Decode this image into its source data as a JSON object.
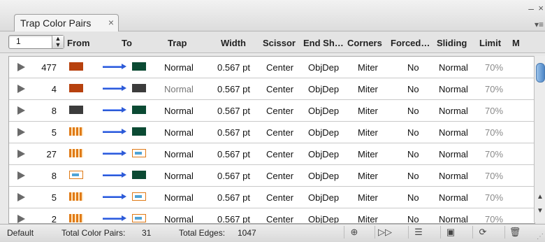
{
  "window": {
    "minimize_glyph": "–",
    "close_glyph": "×",
    "menu_glyph": "▾≡"
  },
  "tab": {
    "label": "Trap Color Pairs",
    "close_glyph": "×"
  },
  "stepper": {
    "value": "1",
    "arrows_glyph": "▲▼"
  },
  "columns": {
    "from": "From",
    "to": "To",
    "trap": "Trap",
    "width": "Width",
    "scissor": "Scissor",
    "end_shape": "End Sh…",
    "corners": "Corners",
    "forced": "Forced…",
    "sliding": "Sliding",
    "limit": "Limit",
    "m": "M"
  },
  "rows": [
    {
      "count": "477",
      "from": "rust",
      "to": "green",
      "trap": "Normal",
      "trap_gray": false,
      "width": "0.567 pt",
      "scissor": "Center",
      "end": "ObjDep",
      "corners": "Miter",
      "forced": "No",
      "sliding": "Normal",
      "limit": "70%"
    },
    {
      "count": "4",
      "from": "rust",
      "to": "dark",
      "trap": "Normal",
      "trap_gray": true,
      "width": "0.567 pt",
      "scissor": "Center",
      "end": "ObjDep",
      "corners": "Miter",
      "forced": "No",
      "sliding": "Normal",
      "limit": "70%"
    },
    {
      "count": "8",
      "from": "dark",
      "to": "green",
      "trap": "Normal",
      "trap_gray": false,
      "width": "0.567 pt",
      "scissor": "Center",
      "end": "ObjDep",
      "corners": "Miter",
      "forced": "No",
      "sliding": "Normal",
      "limit": "70%"
    },
    {
      "count": "5",
      "from": "stripe",
      "to": "green",
      "trap": "Normal",
      "trap_gray": false,
      "width": "0.567 pt",
      "scissor": "Center",
      "end": "ObjDep",
      "corners": "Miter",
      "forced": "No",
      "sliding": "Normal",
      "limit": "70%"
    },
    {
      "count": "27",
      "from": "stripe",
      "to": "img",
      "trap": "Normal",
      "trap_gray": false,
      "width": "0.567 pt",
      "scissor": "Center",
      "end": "ObjDep",
      "corners": "Miter",
      "forced": "No",
      "sliding": "Normal",
      "limit": "70%"
    },
    {
      "count": "8",
      "from": "img",
      "to": "green",
      "trap": "Normal",
      "trap_gray": false,
      "width": "0.567 pt",
      "scissor": "Center",
      "end": "ObjDep",
      "corners": "Miter",
      "forced": "No",
      "sliding": "Normal",
      "limit": "70%"
    },
    {
      "count": "5",
      "from": "stripe",
      "to": "img",
      "trap": "Normal",
      "trap_gray": false,
      "width": "0.567 pt",
      "scissor": "Center",
      "end": "ObjDep",
      "corners": "Miter",
      "forced": "No",
      "sliding": "Normal",
      "limit": "70%"
    },
    {
      "count": "2",
      "from": "stripe",
      "to": "img",
      "trap": "Normal",
      "trap_gray": false,
      "width": "0.567 pt",
      "scissor": "Center",
      "end": "ObjDep",
      "corners": "Miter",
      "forced": "No",
      "sliding": "Normal",
      "limit": "70%"
    }
  ],
  "footer": {
    "preset": "Default",
    "total_pairs_label": "Total Color Pairs:",
    "total_pairs": "31",
    "total_edges_label": "Total Edges:",
    "total_edges": "1047",
    "buttons": [
      {
        "name": "zoom-button",
        "glyph": "⊕"
      },
      {
        "name": "next-trap-button",
        "glyph": "▷▷"
      },
      {
        "name": "list-view-button",
        "glyph": "☰"
      },
      {
        "name": "new-pair-button",
        "glyph": "▣"
      },
      {
        "name": "update-button",
        "glyph": "⟳"
      },
      {
        "name": "delete-button",
        "glyph": "🗑"
      }
    ]
  },
  "colors": {
    "arrow": "#2d5bd8",
    "swatch_rust": "#b7410e",
    "swatch_green": "#0b4a33",
    "swatch_dark": "#3c3c3c",
    "swatch_stripe": "#e07a16",
    "scroll_thumb": "#4c86c7"
  },
  "icons": [
    "disclosure-triangle-icon",
    "swatch-icon",
    "arrow-right-icon",
    "zoom-icon",
    "next-icon",
    "list-icon",
    "new-icon",
    "update-icon",
    "trash-icon"
  ]
}
